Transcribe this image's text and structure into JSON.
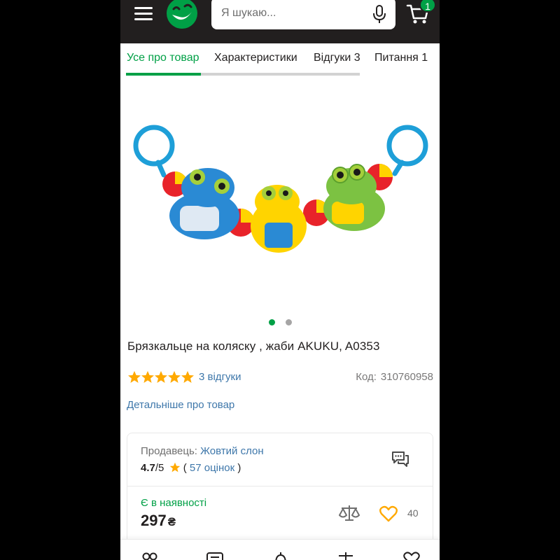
{
  "header": {
    "search_placeholder": "Я шукаю...",
    "cart_count": "1",
    "icons": [
      "menu-icon",
      "logo",
      "microphone-icon",
      "cart-icon"
    ]
  },
  "tabs": [
    {
      "label": "Усе про товар",
      "active": true
    },
    {
      "label": "Характеристики",
      "active": false
    },
    {
      "label": "Відгуки 3",
      "active": false
    },
    {
      "label": "Питання 1",
      "active": false
    }
  ],
  "gallery": {
    "slide_count": 2,
    "current_slide": 1
  },
  "product": {
    "title": "Брязкальце на коляску , жаби AKUKU, A0353",
    "rating_stars": 5,
    "reviews_link": "3 відгуки",
    "code_label": "Код:",
    "code_value": "310760958",
    "details_link": "Детальніше про товар"
  },
  "seller": {
    "label": "Продавець:",
    "name": "Жовтий слон",
    "rating": "4.7",
    "rating_scale": "/5",
    "open_paren": "(",
    "rating_count": "57 оцінок",
    "close_paren": ")"
  },
  "offer": {
    "availability": "Є в наявності",
    "price": "297",
    "currency": "₴",
    "favorites_count": "40"
  },
  "bottom_nav": {
    "icons": [
      "catalog-icon",
      "list-icon",
      "notifications-icon",
      "compare-icon",
      "wishlist-icon"
    ]
  },
  "colors": {
    "brand_green": "#00a046",
    "header_dark": "#221f1f",
    "link_blue": "#3e77aa",
    "star_gold": "#ffa900"
  }
}
